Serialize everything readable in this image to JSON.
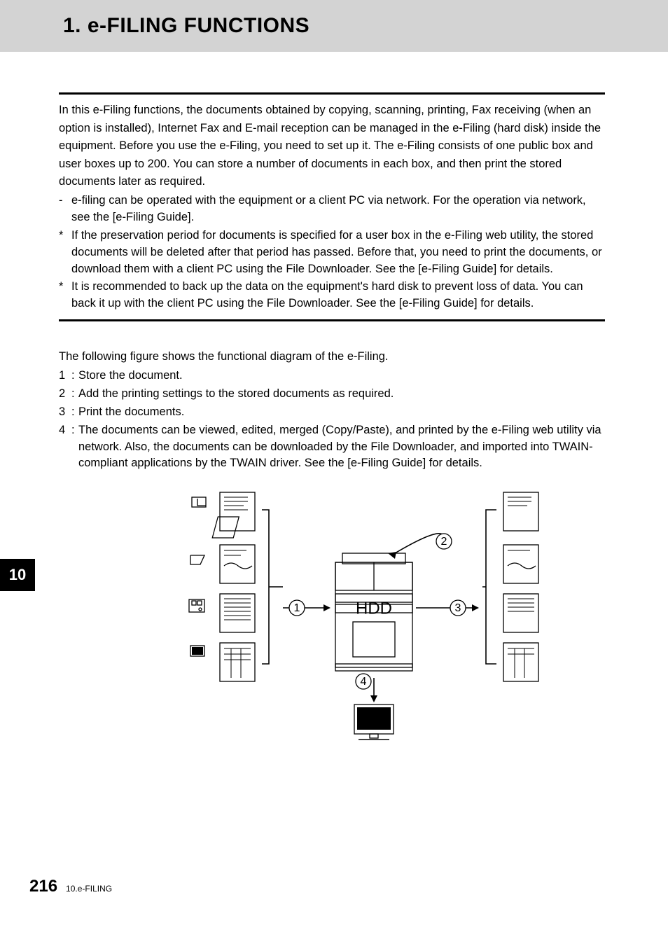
{
  "title": "1. e-FILING FUNCTIONS",
  "intro": "In this e-Filing functions, the documents obtained by copying, scanning, printing, Fax receiving (when an option is installed), Internet Fax and E-mail reception can be managed in the e-Filing (hard disk) inside the equipment. Before you use the e-Filing, you need to set up it. The e-Filing consists of one public box and user boxes up to 200. You can store a number of documents in each box, and then print the stored documents later as required.",
  "bullets": [
    {
      "marker": "-",
      "text": "e-filing can be operated with the equipment or a client PC via network. For the operation via network, see the [e-Filing Guide]."
    },
    {
      "marker": "*",
      "text": "If the preservation period for documents is specified for a user box in the e-Filing web utility, the stored documents will be deleted after that period has passed. Before that, you need to print the documents, or download them with a client PC using the File Downloader. See the [e-Filing Guide] for details."
    },
    {
      "marker": "*",
      "text": "It is recommended to back up the data on the equipment's hard disk to prevent loss of data. You can back it up with the client PC using the File Downloader. See the [e-Filing Guide] for details."
    }
  ],
  "figure_intro": "The following figure shows the functional diagram of the e-Filing.",
  "numbered": [
    {
      "n": "1",
      "text": "Store the document."
    },
    {
      "n": "2",
      "text": "Add the printing settings to the stored documents as required."
    },
    {
      "n": "3",
      "text": "Print the documents."
    },
    {
      "n": "4",
      "text": "The documents can be viewed, edited, merged (Copy/Paste), and printed by the e-Filing web utility via network. Also, the documents can be downloaded by the File Downloader, and imported into TWAIN-compliant applications by the TWAIN driver. See the [e-Filing Guide] for details."
    }
  ],
  "diagram": {
    "center_label": "HDD",
    "callouts": [
      "1",
      "2",
      "3",
      "4"
    ]
  },
  "side_tab": "10",
  "footer": {
    "page": "216",
    "section": "10.e-FILING"
  }
}
